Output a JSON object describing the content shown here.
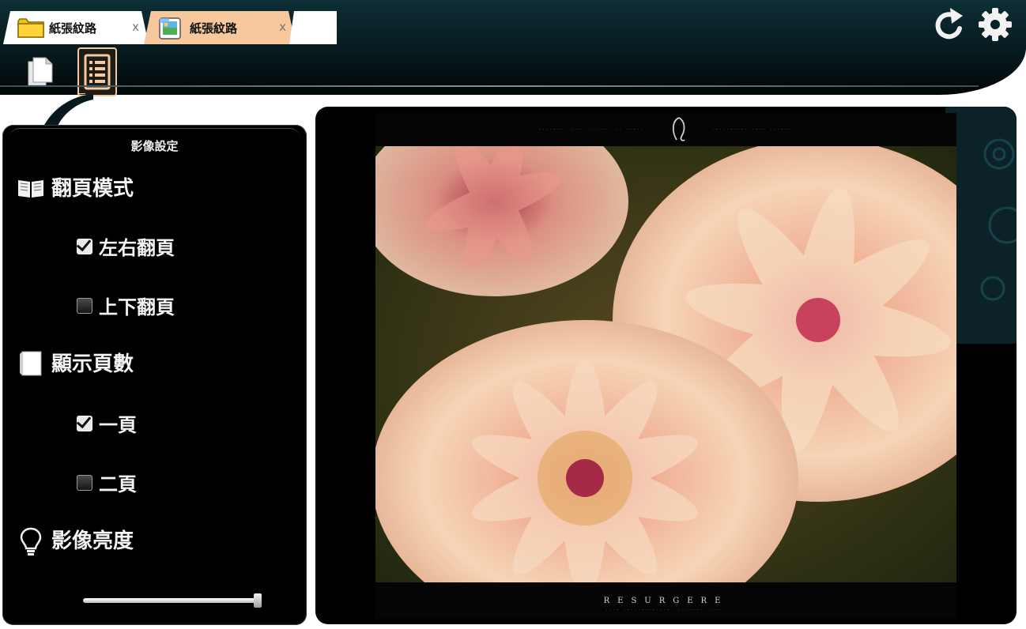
{
  "tabs": [
    {
      "label": "紙張紋路",
      "close": "x",
      "icon": "folder-icon",
      "active": false
    },
    {
      "label": "紙張紋路",
      "close": "x",
      "icon": "image-file-icon",
      "active": true
    }
  ],
  "toolbar": {
    "refresh_icon": "refresh-icon",
    "settings_icon": "gear-icon",
    "pages_icon": "pages-icon",
    "list_icon": "list-icon"
  },
  "settings": {
    "title": "影像設定",
    "page_mode": {
      "heading": "翻頁模式",
      "icon": "open-book-icon",
      "options": [
        {
          "label": "左右翻頁",
          "checked": true
        },
        {
          "label": "上下翻頁",
          "checked": false
        }
      ]
    },
    "page_count": {
      "heading": "顯示頁數",
      "icon": "page-icon",
      "options": [
        {
          "label": "一頁",
          "checked": true
        },
        {
          "label": "二頁",
          "checked": false
        }
      ]
    },
    "brightness": {
      "heading": "影像亮度",
      "icon": "lightbulb-icon",
      "value": 0.98
    }
  },
  "viewer": {
    "photo_title": "RESURGERE",
    "photo_subject": "chrysanthemum-flowers"
  },
  "colors": {
    "active_tab": "#f7c89b",
    "top_bar": "#0c2e35",
    "panel": "#000000",
    "list_icon_border": "#f2c9a0"
  }
}
